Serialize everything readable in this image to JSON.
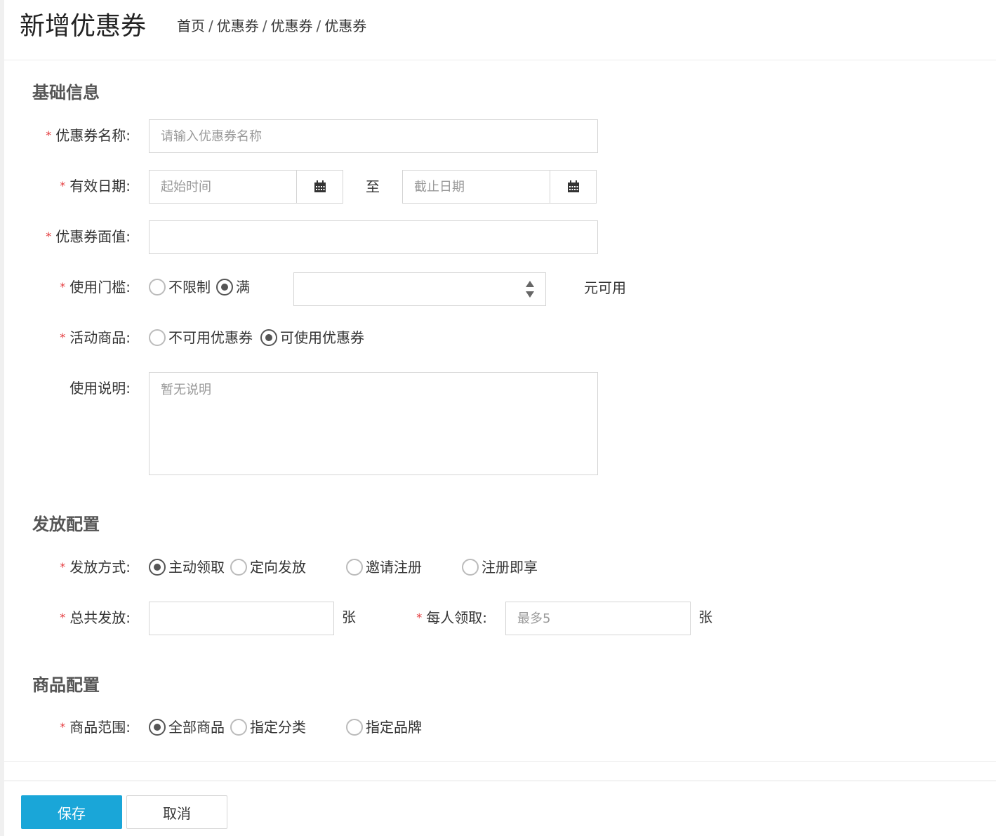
{
  "header": {
    "title": "新增优惠券",
    "breadcrumb": [
      "首页",
      "优惠券",
      "优惠券",
      "优惠券"
    ]
  },
  "basic": {
    "section_title": "基础信息",
    "name": {
      "label": "优惠券名称:",
      "placeholder": "请输入优惠券名称",
      "value": ""
    },
    "validity": {
      "label": "有效日期:",
      "start_placeholder": "起始时间",
      "to_text": "至",
      "end_placeholder": "截止日期",
      "icon": "calendar-icon"
    },
    "face_value": {
      "label": "优惠券面值:",
      "value": ""
    },
    "threshold": {
      "label": "使用门槛:",
      "options": [
        "不限制",
        "满"
      ],
      "selected": "满",
      "amount": "",
      "unit": "元可用"
    },
    "products": {
      "label": "活动商品:",
      "options": [
        "不可用优惠券",
        "可使用优惠券"
      ],
      "selected": "可使用优惠券"
    },
    "description": {
      "label": "使用说明:",
      "placeholder": "暂无说明",
      "value": ""
    }
  },
  "distribution": {
    "section_title": "发放配置",
    "method": {
      "label": "发放方式:",
      "options": [
        "主动领取",
        "定向发放",
        "邀请注册",
        "注册即享"
      ],
      "selected": "主动领取"
    },
    "total": {
      "label": "总共发放:",
      "value": "",
      "unit": "张"
    },
    "per_person": {
      "label": "每人领取:",
      "placeholder": "最多5",
      "value": "",
      "unit": "张"
    }
  },
  "product_config": {
    "section_title": "商品配置",
    "scope": {
      "label": "商品范围:",
      "options": [
        "全部商品",
        "指定分类",
        "指定品牌"
      ],
      "selected": "全部商品"
    }
  },
  "footer": {
    "save_label": "保存",
    "cancel_label": "取消"
  },
  "colors": {
    "primary": "#1aa6d8",
    "required": "#e4393c"
  }
}
